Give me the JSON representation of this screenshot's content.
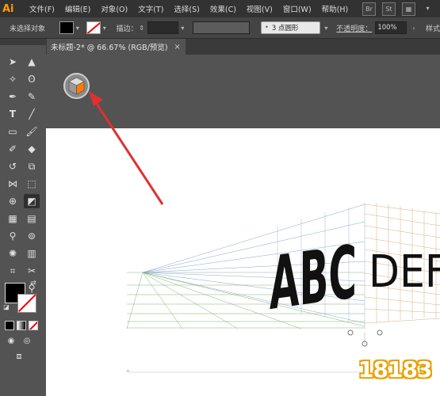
{
  "app": {
    "logo": "Ai"
  },
  "menu": [
    "文件(F)",
    "编辑(E)",
    "对象(O)",
    "文字(T)",
    "选择(S)",
    "效果(C)",
    "视图(V)",
    "窗口(W)",
    "帮助(H)"
  ],
  "menu_right": [
    "Br",
    "St"
  ],
  "options": {
    "selection_status": "未选择对象",
    "stroke_label": "描边：",
    "points_label": "3 点圆形",
    "opacity_label": "不透明度：",
    "opacity_value": "100%",
    "style_label": "样式"
  },
  "document_tab": {
    "title": "未标题-2* @ 66.67% (RGB/预览)",
    "close": "×"
  },
  "artwork": {
    "text_left": "ABC",
    "text_right": "DEF"
  },
  "watermark": "18183",
  "colors": {
    "accent": "#ff7a00",
    "arrow": "#e03030",
    "ui_bg": "#535353",
    "menubar": "#323232"
  }
}
